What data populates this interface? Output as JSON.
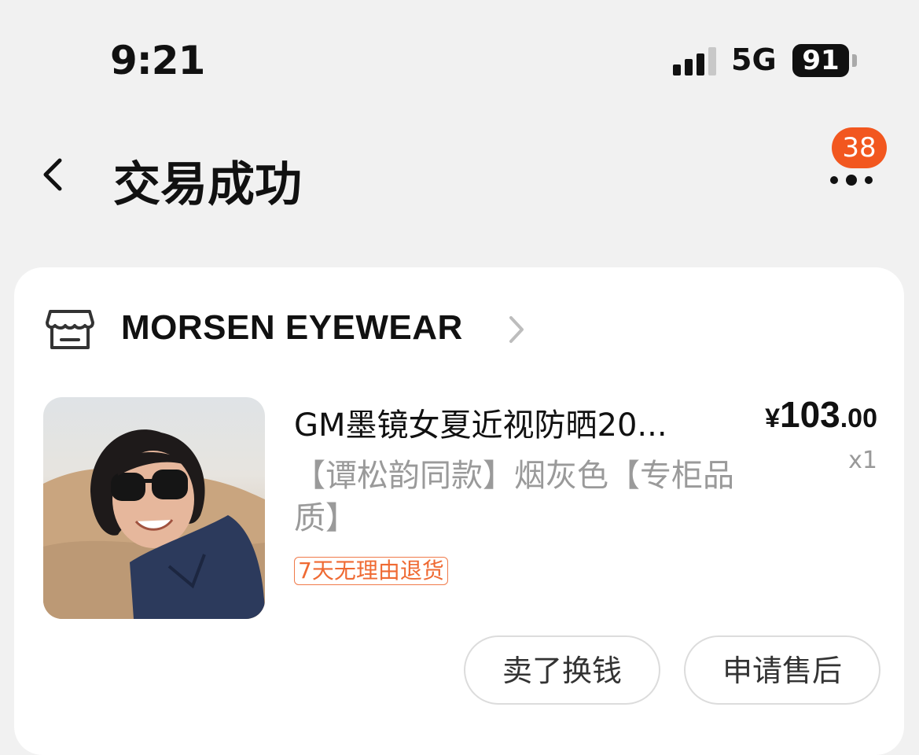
{
  "status": {
    "time": "9:21",
    "network": "5G",
    "battery": "91"
  },
  "nav": {
    "title": "交易成功",
    "badge_count": "38"
  },
  "shop": {
    "name": "MORSEN EYEWEAR"
  },
  "product": {
    "title": "GM墨镜女夏近视防晒20...",
    "spec": "【谭松韵同款】烟灰色【专柜品质】",
    "price_symbol": "¥",
    "price_int": "103",
    "price_dec": ".00",
    "quantity": "x1",
    "return_tag": "7天无理由退货"
  },
  "actions": {
    "sell_label": "卖了换钱",
    "after_sale_label": "申请售后"
  },
  "colors": {
    "accent_orange": "#f2571f",
    "tag_orange": "#ef6a33",
    "background": "#f1f1f1"
  }
}
